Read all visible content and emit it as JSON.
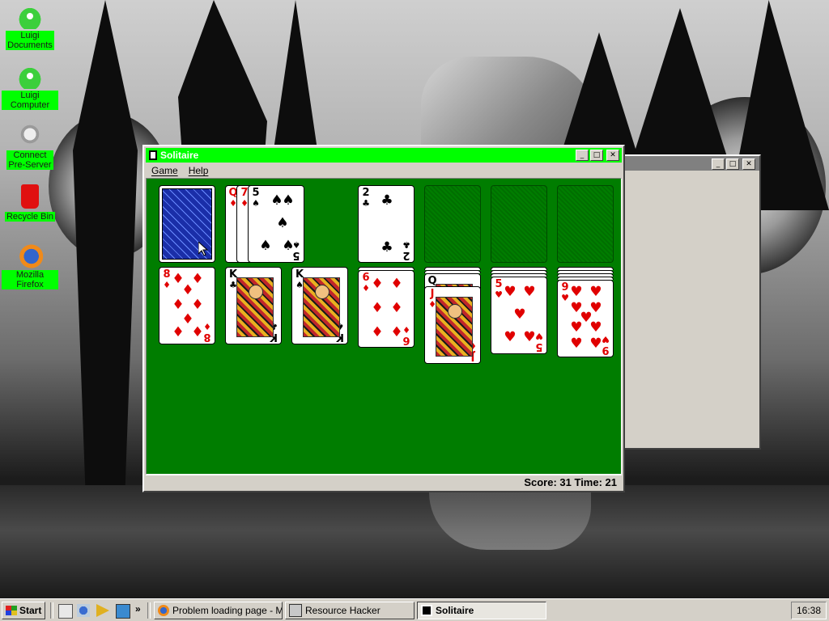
{
  "desktop": {
    "icons": [
      {
        "label_line1": "Luigi",
        "label_line2": "Documents",
        "icon": "luigi-documents-icon"
      },
      {
        "label_line1": "Luigi Computer",
        "label_line2": "",
        "icon": "luigi-computer-icon"
      },
      {
        "label_line1": "Connect",
        "label_line2": "Pre-Server",
        "icon": "server-icon"
      },
      {
        "label_line1": "Recycle Bin",
        "label_line2": "",
        "icon": "recycle-bin-icon"
      },
      {
        "label_line1": "Mozilla Firefox",
        "label_line2": "",
        "icon": "firefox-icon"
      }
    ]
  },
  "window": {
    "title": "Solitaire",
    "accent": "#00ff00",
    "felt_color": "#007d00",
    "menu": [
      "Game",
      "Help"
    ],
    "controls": {
      "minimize": "_",
      "maximize": "□",
      "close": "✕"
    }
  },
  "game": {
    "stock": "face-down deck",
    "waste": [
      {
        "rank": "Q",
        "suit": "♦",
        "color": "red"
      },
      {
        "rank": "7",
        "suit": "♦",
        "color": "red"
      },
      {
        "rank": "5",
        "suit": "♠",
        "color": "black"
      }
    ],
    "foundations": [
      {
        "rank": "2",
        "suit": "♣",
        "color": "black"
      },
      null,
      null,
      null
    ],
    "tableau": [
      {
        "hidden": 0,
        "top": {
          "rank": "8",
          "suit": "♦",
          "color": "red"
        }
      },
      {
        "hidden": 0,
        "top": {
          "rank": "K",
          "suit": "♣",
          "color": "black"
        }
      },
      {
        "hidden": 0,
        "top": {
          "rank": "K",
          "suit": "♠",
          "color": "black"
        }
      },
      {
        "hidden": 1,
        "top": {
          "rank": "6",
          "suit": "♦",
          "color": "red"
        }
      },
      {
        "hidden": 2,
        "under": {
          "rank": "Q",
          "suit": "♠",
          "color": "black"
        },
        "top": {
          "rank": "J",
          "suit": "♦",
          "color": "red"
        }
      },
      {
        "hidden": 3,
        "top": {
          "rank": "5",
          "suit": "♥",
          "color": "red"
        }
      },
      {
        "hidden": 4,
        "top": {
          "rank": "9",
          "suit": "♥",
          "color": "red"
        }
      }
    ],
    "status": "Score: 31 Time: 21"
  },
  "taskbar": {
    "start_label": "Start",
    "more_label": "»",
    "tasks": [
      {
        "label": "Problem loading page - Mo...",
        "icon": "firefox-icon",
        "active": false
      },
      {
        "label": "Resource Hacker",
        "icon": "resource-hacker-icon",
        "active": false
      },
      {
        "label": "Solitaire",
        "icon": "solitaire-icon",
        "active": true
      }
    ],
    "clock": "16:38"
  }
}
